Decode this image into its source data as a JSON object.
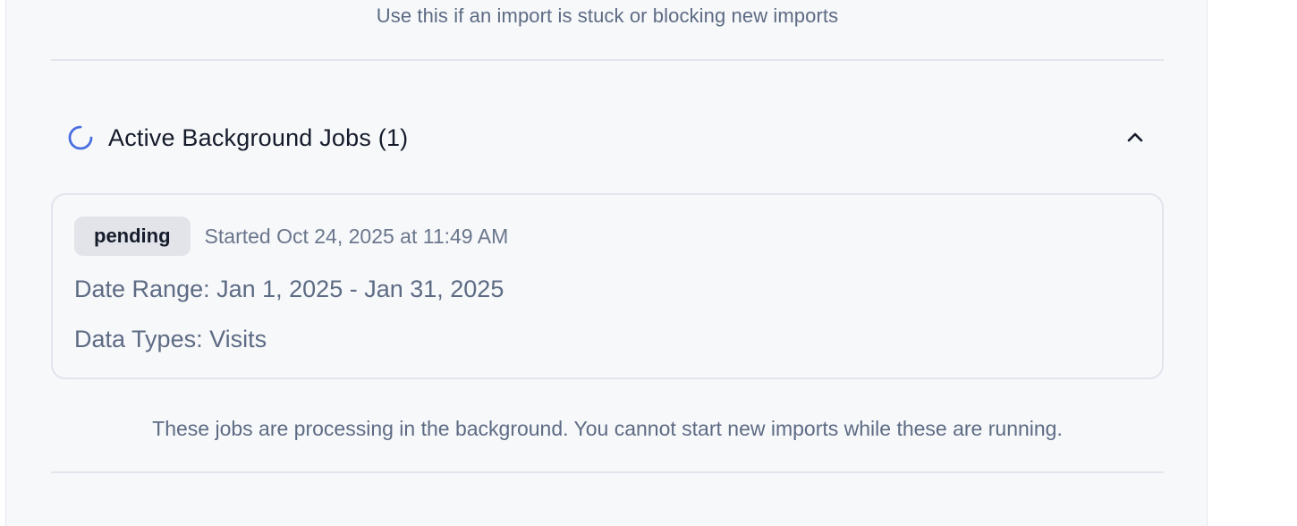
{
  "reset_section": {
    "help_text": "Use this if an import is stuck or blocking new imports"
  },
  "active_jobs": {
    "title": "Active Background Jobs (1)",
    "spinner_icon": "loading-spinner-icon",
    "collapse_icon": "chevron-up-icon",
    "accent_color": "#4a6fe0",
    "jobs": [
      {
        "status": "pending",
        "started": "Started Oct 24, 2025 at 11:49 AM",
        "date_range": "Date Range: Jan 1, 2025 - Jan 31, 2025",
        "data_types": "Data Types: Visits"
      }
    ],
    "footer_note": "These jobs are processing in the background. You cannot start new imports while these are running."
  }
}
